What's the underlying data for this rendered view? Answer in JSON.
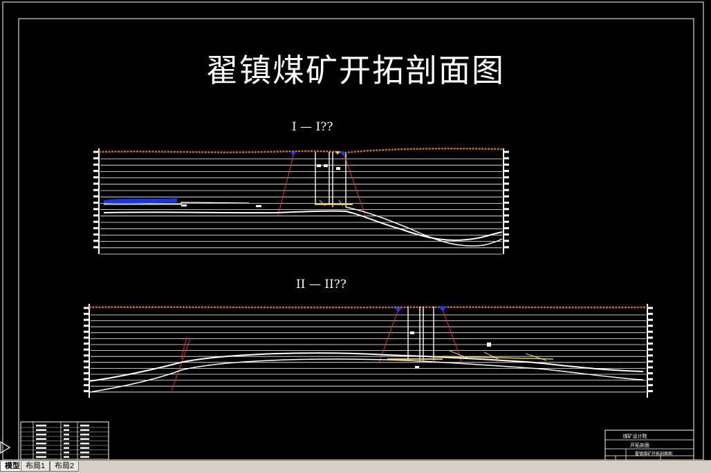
{
  "drawing": {
    "title": "翟镇煤矿开拓剖面图",
    "section1_title": "I — I??",
    "section2_title": "II — II??"
  },
  "title_block": {
    "line1": "煤矿设计院",
    "line2": "开拓剖面",
    "line3": "翟镇煤矿开拓剖面图"
  },
  "tabs": [
    {
      "label": "模型",
      "active": true
    },
    {
      "label": "布局1",
      "active": false
    },
    {
      "label": "布局2",
      "active": false
    }
  ],
  "colors": {
    "background": "#000000",
    "lines": "#ffffff",
    "terrain": "#c8702a",
    "shaft_marker": "#1a3cff",
    "fault": "#d83a2a",
    "seam_highlight": "#e8c84a"
  }
}
